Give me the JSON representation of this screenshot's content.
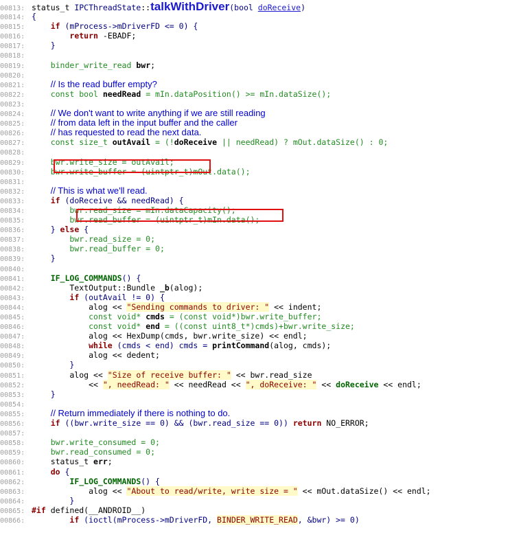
{
  "lines": [
    {
      "n": "00813:",
      "t": [
        [
          "p",
          "status_t "
        ],
        [
          "f",
          "IPCThreadState"
        ],
        [
          "p",
          "::"
        ],
        [
          "fname",
          "talkWithDriver"
        ],
        [
          "f",
          "(bool "
        ],
        [
          "param",
          "doReceive"
        ],
        [
          "f",
          ")"
        ]
      ]
    },
    {
      "n": "00814:",
      "t": [
        [
          "f",
          "{"
        ]
      ]
    },
    {
      "n": "00815:",
      "t": [
        [
          "p",
          "    "
        ],
        [
          "k",
          "if"
        ],
        [
          "f",
          " (mProcess->mDriverFD <= 0) {"
        ]
      ]
    },
    {
      "n": "00816:",
      "t": [
        [
          "p",
          "        "
        ],
        [
          "k",
          "return"
        ],
        [
          "p",
          " -EBADF;"
        ]
      ]
    },
    {
      "n": "00817:",
      "t": [
        [
          "f",
          "    }"
        ]
      ]
    },
    {
      "n": "00818:",
      "t": []
    },
    {
      "n": "00819:",
      "t": [
        [
          "p",
          "    "
        ],
        [
          "kn",
          "binder_write_read"
        ],
        [
          "p",
          " "
        ],
        [
          "lv",
          "bwr"
        ],
        [
          "p",
          ";"
        ]
      ]
    },
    {
      "n": "00820:",
      "t": []
    },
    {
      "n": "00821:",
      "t": [
        [
          "p",
          "    "
        ],
        [
          "c",
          "// Is the read buffer empty?"
        ]
      ]
    },
    {
      "n": "00822:",
      "t": [
        [
          "p",
          "    "
        ],
        [
          "kn",
          "const bool "
        ],
        [
          "lv",
          "needRead"
        ],
        [
          "kn",
          " = mIn.dataPosition() >= mIn.dataSize();"
        ]
      ]
    },
    {
      "n": "00823:",
      "t": []
    },
    {
      "n": "00824:",
      "t": [
        [
          "p",
          "    "
        ],
        [
          "c",
          "// We don't want to write anything if we are still reading"
        ]
      ]
    },
    {
      "n": "00825:",
      "t": [
        [
          "p",
          "    "
        ],
        [
          "c",
          "// from data left in the input buffer and the caller"
        ]
      ]
    },
    {
      "n": "00826:",
      "t": [
        [
          "p",
          "    "
        ],
        [
          "c",
          "// has requested to read the next data."
        ]
      ]
    },
    {
      "n": "00827:",
      "t": [
        [
          "p",
          "    "
        ],
        [
          "kn",
          "const size_t "
        ],
        [
          "lv",
          "outAvail"
        ],
        [
          "kn",
          " = (!"
        ],
        [
          "lv",
          "doReceive"
        ],
        [
          "kn",
          " || needRead) ? mOut.dataSize() : 0;"
        ]
      ]
    },
    {
      "n": "00828:",
      "t": []
    },
    {
      "n": "00829:",
      "t": [
        [
          "p",
          "    "
        ],
        [
          "kn",
          "bwr.write_size = outAvail;"
        ]
      ]
    },
    {
      "n": "00830:",
      "t": [
        [
          "p",
          "    "
        ],
        [
          "kn",
          "bwr.write_buffer = (uintptr_t)mOut.data();"
        ]
      ]
    },
    {
      "n": "00831:",
      "t": []
    },
    {
      "n": "00832:",
      "t": [
        [
          "p",
          "    "
        ],
        [
          "c",
          "// This is what we'll read."
        ]
      ]
    },
    {
      "n": "00833:",
      "t": [
        [
          "p",
          "    "
        ],
        [
          "k",
          "if"
        ],
        [
          "f",
          " (doReceive && needRead) {"
        ]
      ]
    },
    {
      "n": "00834:",
      "t": [
        [
          "p",
          "        "
        ],
        [
          "kn",
          "bwr.read_size = mIn.dataCapacity();"
        ]
      ]
    },
    {
      "n": "00835:",
      "t": [
        [
          "p",
          "        "
        ],
        [
          "kn",
          "bwr.read_buffer = (uintptr_t)mIn.data();"
        ]
      ]
    },
    {
      "n": "00836:",
      "t": [
        [
          "f",
          "    } "
        ],
        [
          "k",
          "else"
        ],
        [
          "f",
          " {"
        ]
      ]
    },
    {
      "n": "00837:",
      "t": [
        [
          "p",
          "        "
        ],
        [
          "kn",
          "bwr.read_size = 0;"
        ]
      ]
    },
    {
      "n": "00838:",
      "t": [
        [
          "p",
          "        "
        ],
        [
          "kn",
          "bwr.read_buffer = 0;"
        ]
      ]
    },
    {
      "n": "00839:",
      "t": [
        [
          "f",
          "    }"
        ]
      ]
    },
    {
      "n": "00840:",
      "t": []
    },
    {
      "n": "00841:",
      "t": [
        [
          "p",
          "    "
        ],
        [
          "mac",
          "IF_LOG_COMMANDS"
        ],
        [
          "f",
          "() {"
        ]
      ]
    },
    {
      "n": "00842:",
      "t": [
        [
          "p",
          "        TextOutput::Bundle "
        ],
        [
          "lv",
          "_b"
        ],
        [
          "p",
          "(alog);"
        ]
      ]
    },
    {
      "n": "00843:",
      "t": [
        [
          "p",
          "        "
        ],
        [
          "k",
          "if"
        ],
        [
          "f",
          " (outAvail != 0) {"
        ]
      ]
    },
    {
      "n": "00844:",
      "t": [
        [
          "p",
          "            alog << "
        ],
        [
          "s",
          "\"Sending commands to driver: \""
        ],
        [
          "p",
          " << indent;"
        ]
      ]
    },
    {
      "n": "00845:",
      "t": [
        [
          "p",
          "            "
        ],
        [
          "kn",
          "const void* "
        ],
        [
          "lv",
          "cmds"
        ],
        [
          "kn",
          " = (const void*)bwr.write_buffer;"
        ]
      ]
    },
    {
      "n": "00846:",
      "t": [
        [
          "p",
          "            "
        ],
        [
          "kn",
          "const void* "
        ],
        [
          "lv",
          "end"
        ],
        [
          "kn",
          " = ((const uint8_t*)cmds)+bwr.write_size;"
        ]
      ]
    },
    {
      "n": "00847:",
      "t": [
        [
          "p",
          "            alog << HexDump(cmds, bwr.write_size) << endl;"
        ]
      ]
    },
    {
      "n": "00848:",
      "t": [
        [
          "p",
          "            "
        ],
        [
          "k",
          "while"
        ],
        [
          "f",
          " (cmds < end) cmds = "
        ],
        [
          "lv",
          "printCommand"
        ],
        [
          "p",
          "(alog, cmds);"
        ]
      ]
    },
    {
      "n": "00849:",
      "t": [
        [
          "p",
          "            alog << dedent;"
        ]
      ]
    },
    {
      "n": "00850:",
      "t": [
        [
          "f",
          "        }"
        ]
      ]
    },
    {
      "n": "00851:",
      "t": [
        [
          "p",
          "        alog << "
        ],
        [
          "s",
          "\"Size of receive buffer: \""
        ],
        [
          "p",
          " << bwr.read_size"
        ]
      ]
    },
    {
      "n": "00852:",
      "t": [
        [
          "p",
          "            << "
        ],
        [
          "s",
          "\", needRead: \""
        ],
        [
          "p",
          " << needRead << "
        ],
        [
          "s",
          "\", doReceive: \""
        ],
        [
          "p",
          " << "
        ],
        [
          "mac",
          "doReceive"
        ],
        [
          "p",
          " << endl;"
        ]
      ]
    },
    {
      "n": "00853:",
      "t": [
        [
          "f",
          "    }"
        ]
      ]
    },
    {
      "n": "00854:",
      "t": []
    },
    {
      "n": "00855:",
      "t": [
        [
          "p",
          "    "
        ],
        [
          "c",
          "// Return immediately if there is nothing to do."
        ]
      ]
    },
    {
      "n": "00856:",
      "t": [
        [
          "p",
          "    "
        ],
        [
          "k",
          "if"
        ],
        [
          "f",
          " ((bwr.write_size == 0) && (bwr.read_size == 0)) "
        ],
        [
          "k",
          "return"
        ],
        [
          "p",
          " NO_ERROR;"
        ]
      ]
    },
    {
      "n": "00857:",
      "t": []
    },
    {
      "n": "00858:",
      "t": [
        [
          "p",
          "    "
        ],
        [
          "kn",
          "bwr.write_consumed = 0;"
        ]
      ]
    },
    {
      "n": "00859:",
      "t": [
        [
          "p",
          "    "
        ],
        [
          "kn",
          "bwr.read_consumed = 0;"
        ]
      ]
    },
    {
      "n": "00860:",
      "t": [
        [
          "p",
          "    status_t "
        ],
        [
          "lv",
          "err"
        ],
        [
          "p",
          ";"
        ]
      ]
    },
    {
      "n": "00861:",
      "t": [
        [
          "p",
          "    "
        ],
        [
          "k",
          "do"
        ],
        [
          "f",
          " {"
        ]
      ]
    },
    {
      "n": "00862:",
      "t": [
        [
          "p",
          "        "
        ],
        [
          "mac",
          "IF_LOG_COMMANDS"
        ],
        [
          "f",
          "() {"
        ]
      ]
    },
    {
      "n": "00863:",
      "t": [
        [
          "p",
          "            alog << "
        ],
        [
          "s",
          "\"About to read/write, write size = \""
        ],
        [
          "p",
          " << mOut.dataSize() << endl;"
        ]
      ]
    },
    {
      "n": "00864:",
      "t": [
        [
          "f",
          "        }"
        ]
      ]
    },
    {
      "n": "00865:",
      "t": [
        [
          "k",
          "#if"
        ],
        [
          "p",
          " defined(__ANDROID__)"
        ]
      ]
    },
    {
      "n": "00866:",
      "t": [
        [
          "p",
          "        "
        ],
        [
          "k",
          "if"
        ],
        [
          "f",
          " (ioctl(mProcess->mDriverFD, "
        ],
        [
          "s",
          "BINDER_WRITE_READ"
        ],
        [
          "f",
          ", &bwr) >= 0)"
        ]
      ]
    }
  ]
}
